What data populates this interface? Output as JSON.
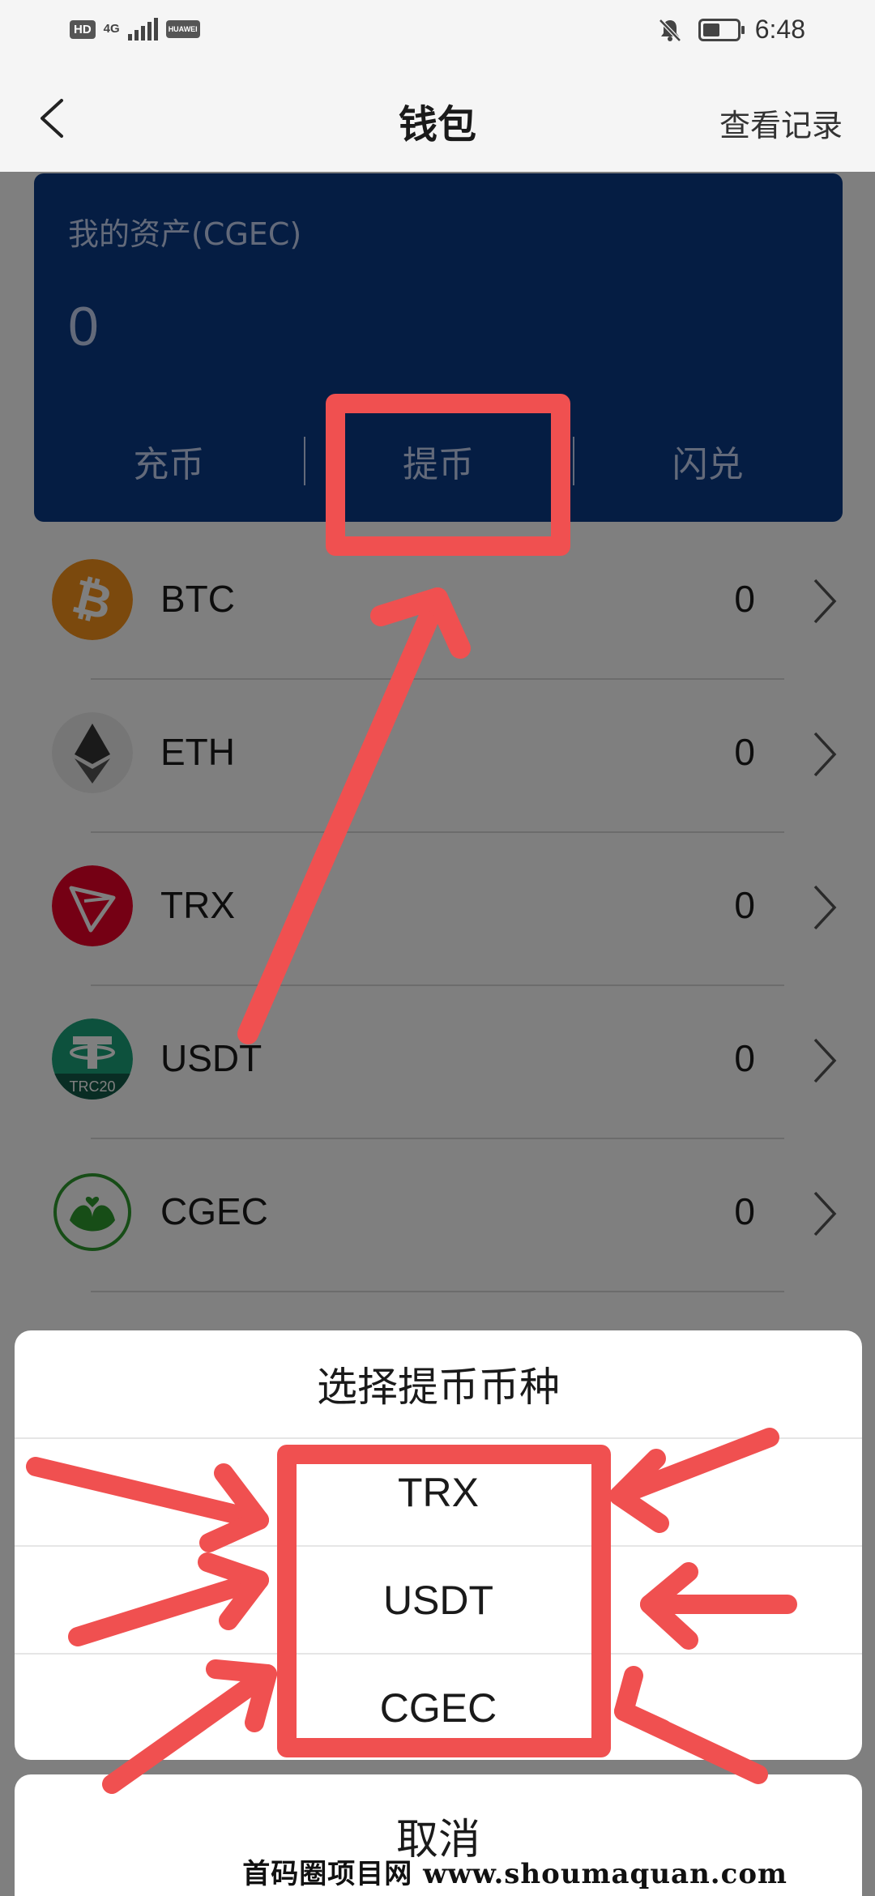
{
  "status_bar": {
    "badge": "HD",
    "network": "4G",
    "carrier_logo": "HUAWEI",
    "time": "6:48",
    "icons": [
      "mute-bell-icon",
      "battery-icon",
      "signal-icon"
    ]
  },
  "header": {
    "title": "钱包",
    "right_link": "查看记录",
    "back_icon": "chevron-left-icon"
  },
  "asset_card": {
    "label": "我的资产(CGEC)",
    "amount": "0",
    "actions": [
      "充币",
      "提币",
      "闪兑"
    ],
    "background_color": "#0b3b86"
  },
  "coins": [
    {
      "name": "BTC",
      "amount": "0",
      "icon": "bitcoin-icon",
      "color": "#f7931a"
    },
    {
      "name": "ETH",
      "amount": "0",
      "icon": "ethereum-icon",
      "color": "#ececec"
    },
    {
      "name": "TRX",
      "amount": "0",
      "icon": "tron-icon",
      "color": "#eb0029"
    },
    {
      "name": "USDT",
      "amount": "0",
      "icon": "tether-trc20-icon",
      "color": "#1ba27a",
      "icon_text": "TRC20"
    },
    {
      "name": "CGEC",
      "amount": "0",
      "icon": "cgec-leaf-icon",
      "color": "#2e9b2e"
    }
  ],
  "sheet": {
    "title": "选择提币币种",
    "options": [
      "TRX",
      "USDT",
      "CGEC"
    ],
    "cancel": "取消"
  },
  "annotation_color": "#f05050",
  "watermark": "首码圈项目网 www.shoumaquan.com"
}
